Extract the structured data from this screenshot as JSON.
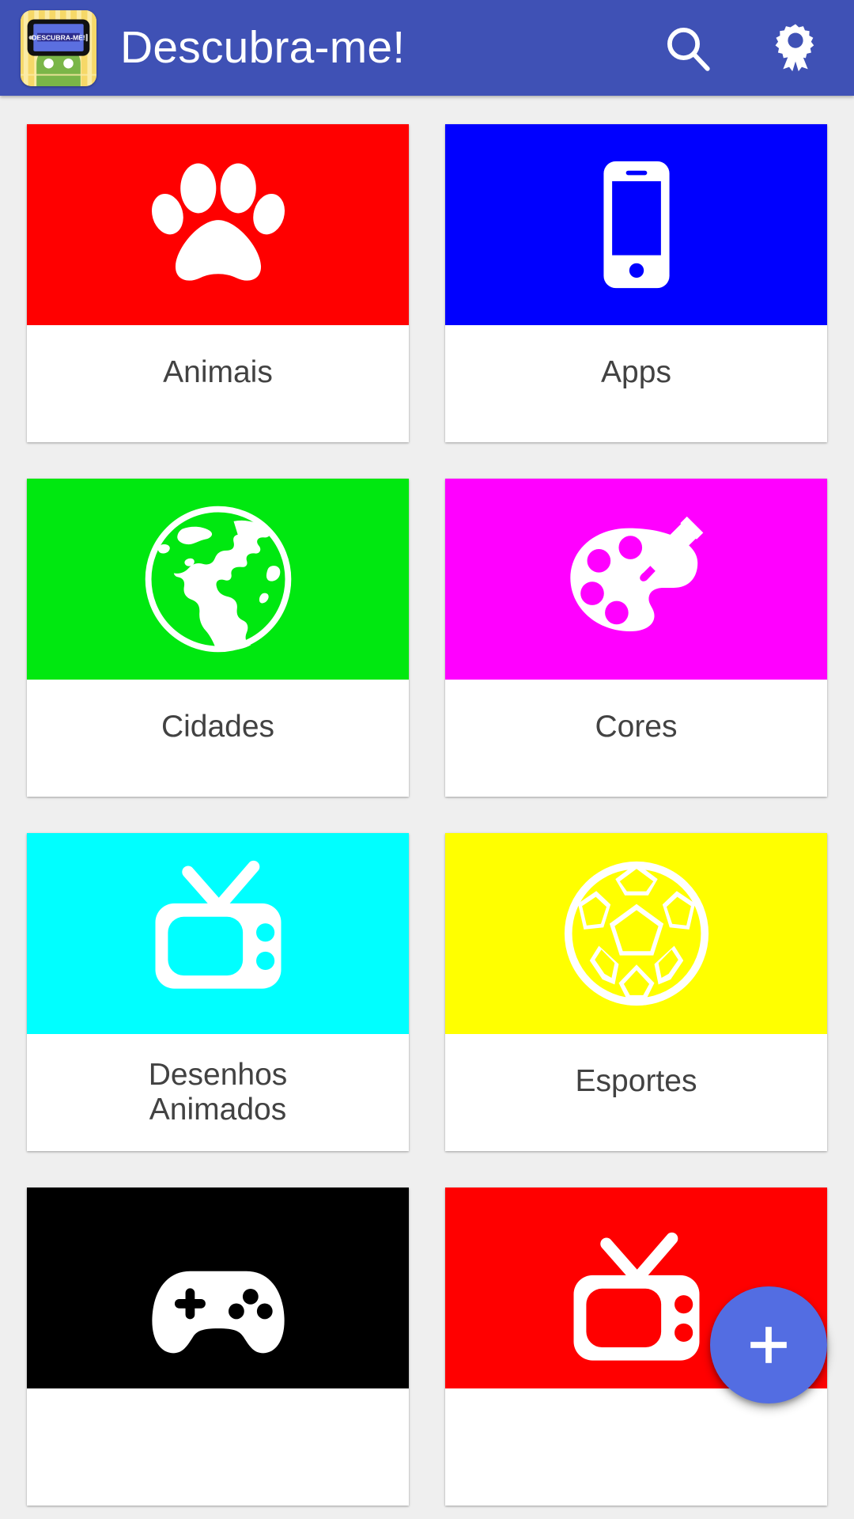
{
  "appbar": {
    "title": "Descubra-me!",
    "logo_text": "DESCUBRA-ME!",
    "logo_name": "app-logo-android-with-phone",
    "background_color": "#3F51B5",
    "title_color": "#FFFFFF",
    "actions": [
      {
        "name": "search-icon",
        "label": "Pesquisar"
      },
      {
        "name": "award-ribbon-icon",
        "label": "Conquistas"
      }
    ]
  },
  "fab": {
    "label": "+",
    "name": "add-category-fab",
    "color": "#536DE2"
  },
  "page": {
    "background_color": "#EFEFEF",
    "label_color": "#424242",
    "card_background": "#FFFFFF"
  },
  "cards": [
    {
      "label": "Animais",
      "color": "#FF0000",
      "icon": "paw-icon"
    },
    {
      "label": "Apps",
      "color": "#0000FF",
      "icon": "smartphone-icon"
    },
    {
      "label": "Cidades",
      "color": "#00E810",
      "icon": "globe-icon"
    },
    {
      "label": "Cores",
      "color": "#FF00FF",
      "icon": "palette-icon"
    },
    {
      "label": "Desenhos\nAnimados",
      "color": "#00FFFF",
      "icon": "television-icon"
    },
    {
      "label": "Esportes",
      "color": "#FFFF00",
      "icon": "soccer-ball-icon"
    },
    {
      "label": "",
      "color": "#000000",
      "icon": "gamepad-icon"
    },
    {
      "label": "",
      "color": "#FF0000",
      "icon": "television-icon"
    }
  ]
}
